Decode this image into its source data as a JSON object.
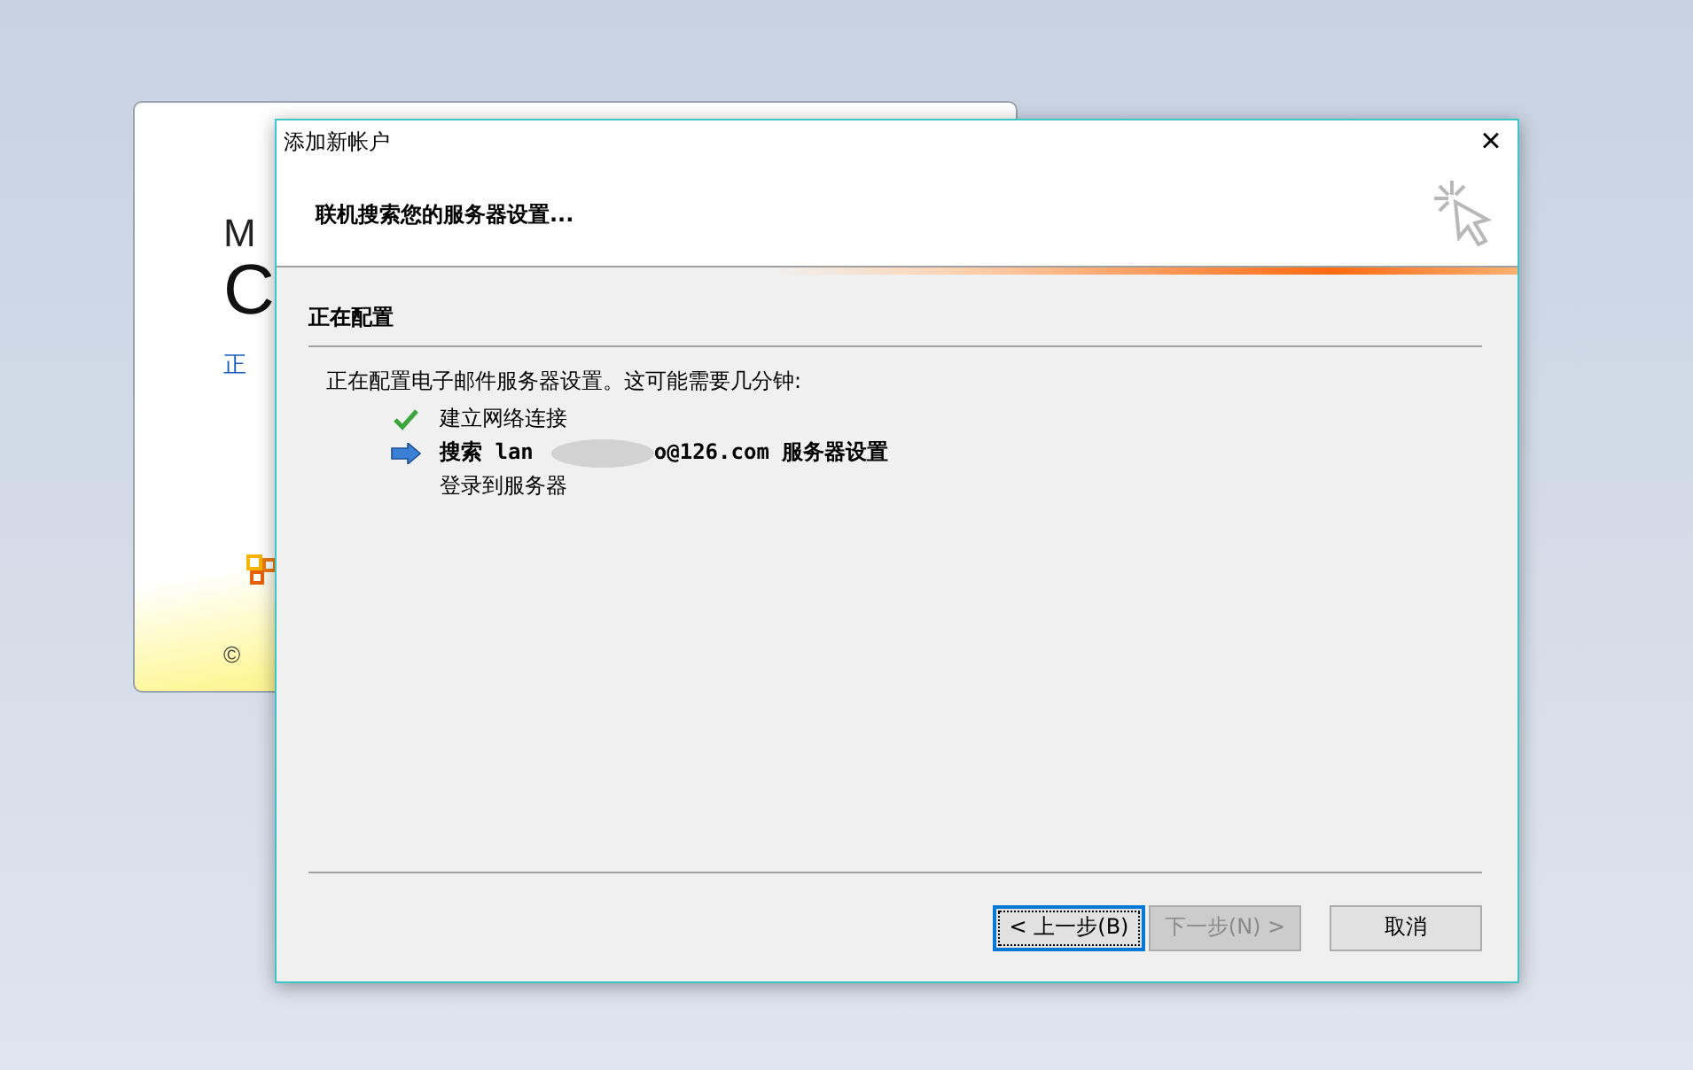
{
  "background_window": {
    "texts": [
      "M",
      "C",
      "正",
      "©"
    ]
  },
  "dialog": {
    "title": "添加新帐户",
    "close": "×",
    "header": "联机搜索您的服务器设置...",
    "section_title": "正在配置",
    "intro": "正在配置电子邮件服务器设置。这可能需要几分钟:",
    "steps": [
      {
        "kind": "done",
        "text": "建立网络连接"
      },
      {
        "kind": "current",
        "text": "搜索 lan",
        "text_after": "o@126.com 服务器设置"
      },
      {
        "kind": "pending",
        "text": "登录到服务器"
      }
    ],
    "buttons": [
      {
        "label": "< 上一步(B)",
        "disabled": false,
        "focused": true
      },
      {
        "label": "下一步(N) >",
        "disabled": true,
        "focused": false
      },
      {
        "label": "取消",
        "disabled": false,
        "focused": false
      }
    ]
  }
}
